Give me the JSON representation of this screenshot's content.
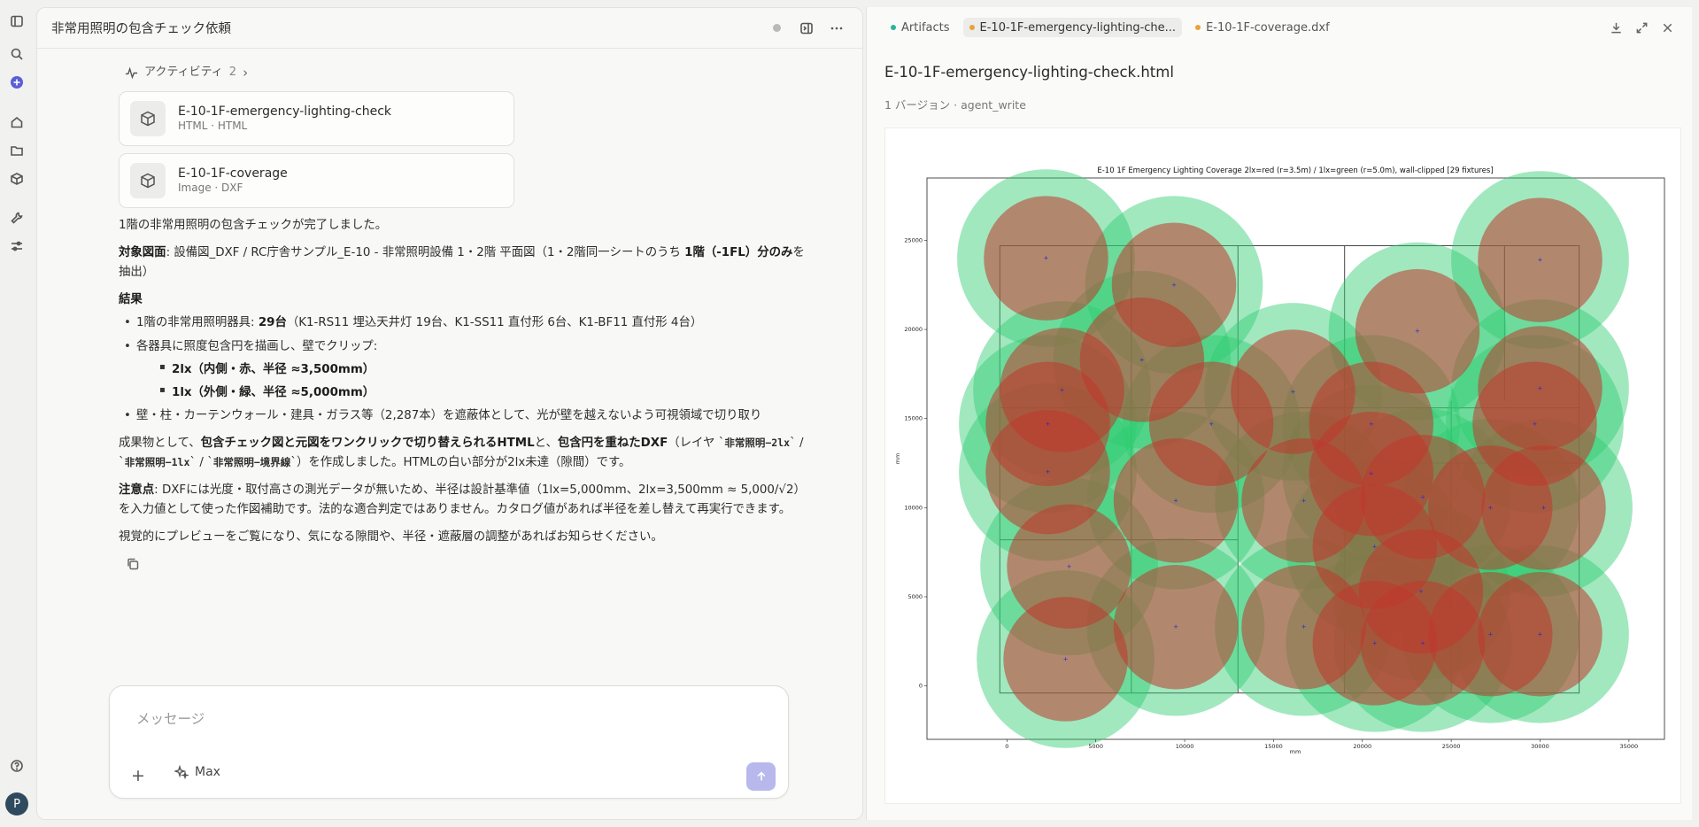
{
  "rail": {
    "icons": [
      "sidebar-toggle-icon",
      "search-icon",
      "new-chat-icon",
      "home-icon",
      "folder-icon",
      "artifacts-icon",
      "tools-icon",
      "settings-sliders-icon",
      "help-icon"
    ],
    "avatar_letter": "P",
    "accent": "#5a5fd6"
  },
  "chat": {
    "title": "非常用照明の包含チェック依頼",
    "activity_label": "アクティビティ",
    "activity_count": "2",
    "artifacts": [
      {
        "name": "E-10-1F-emergency-lighting-check",
        "sub": "HTML · HTML"
      },
      {
        "name": "E-10-1F-coverage",
        "sub": "Image · DXF"
      }
    ],
    "p1": "1階の非常用照明の包含チェックが完了しました。",
    "p2_bold": "対象図面",
    "p2_a": ": 設備図_DXF / RC庁舎サンプル_E-10 - 非常照明設備 1・2階 平面図（1・2階同一シートのうち ",
    "p2_bold2": "1階（-1FL）分のみ",
    "p2_b": "を抽出）",
    "result_heading": "結果",
    "b1_a": "1階の非常用照明器具: ",
    "b1_bold": "29台",
    "b1_b": "（K1-RS11 埋込天井灯 19台、K1-SS11 直付形 6台、K1-BF11 直付形 4台）",
    "b2": "各器具に照度包含円を描画し、壁でクリップ:",
    "sub1": "2lx（内側・赤、半径 ≈3,500mm）",
    "sub2": "1lx（外側・緑、半径 ≈5,000mm）",
    "b3": "壁・柱・カーテンウォール・建具・ガラス等（2,287本）を遮蔽体として、光が壁を越えないよう可視領域で切り取り",
    "p4_a": "成果物として、",
    "p4_bold": "包含チェック図と元図をワンクリックで切り替えられるHTML",
    "p4_b": "と、",
    "p4_bold2": "包含円を重ねたDXF",
    "p4_c": "（レイヤ `",
    "p4_code1": "非常照明−2lx",
    "p4_d": "` / `",
    "p4_code2": "非常照明−1lx",
    "p4_e": "` / `",
    "p4_code3": "非常照明−境界線",
    "p4_f": "`）を作成しました。HTMLの白い部分が2lx未達（隙間）です。",
    "p5_bold": "注意点",
    "p5": ": DXFには光度・取付高さの測光データが無いため、半径は設計基準値（1lx=5,000mm、2lx=3,500mm ≈ 5,000/√2）を入力値として使った作図補助です。法的な適合判定ではありません。カタログ値があれば半径を差し替えて再実行できます。",
    "p6": "視覚的にプレビューをご覧になり、気になる隙間や、半径・遮蔽層の調整があればお知らせください。",
    "composer_placeholder": "メッセージ",
    "model_label": "Max"
  },
  "artifacts_pane": {
    "tab_artifacts": "Artifacts",
    "tab1": "E-10-1F-emergency-lighting-che...",
    "tab2": "E-10-1F-coverage.dxf",
    "title": "E-10-1F-emergency-lighting-check.html",
    "meta": "1 バージョン · agent_write",
    "tab_dot_teal": "#2bb39a",
    "tab_dot_orange": "#e8a23a"
  },
  "chart_data": {
    "type": "scatter",
    "title": "E-10 1F Emergency Lighting Coverage   2lx=red (r=3.5m) / 1lx=green (r=5.0m), wall-clipped   [29 fixtures]",
    "xlabel": "mm",
    "ylabel": "mm",
    "xlim": [
      -4500,
      37000
    ],
    "ylim": [
      -3000,
      28500
    ],
    "xticks": [
      0,
      5000,
      10000,
      15000,
      20000,
      25000,
      30000,
      35000
    ],
    "yticks": [
      0,
      5000,
      10000,
      15000,
      20000,
      25000
    ],
    "colors": {
      "red": "#c0392b",
      "green": "#2ecc71",
      "brown": "#b4705e",
      "fixture": "#2a2ad0"
    },
    "radius_2lx": 3500,
    "radius_1lx": 5000,
    "fixtures": [
      {
        "x": 2200,
        "y": 24000
      },
      {
        "x": 9400,
        "y": 22500
      },
      {
        "x": 23100,
        "y": 19900
      },
      {
        "x": 30000,
        "y": 23900
      },
      {
        "x": 7600,
        "y": 18300
      },
      {
        "x": 3100,
        "y": 16600
      },
      {
        "x": 16100,
        "y": 16500
      },
      {
        "x": 30000,
        "y": 16700
      },
      {
        "x": 2300,
        "y": 14700
      },
      {
        "x": 11500,
        "y": 14700
      },
      {
        "x": 20500,
        "y": 14700
      },
      {
        "x": 29700,
        "y": 14700
      },
      {
        "x": 2300,
        "y": 12000
      },
      {
        "x": 20500,
        "y": 11900
      },
      {
        "x": 9500,
        "y": 10400
      },
      {
        "x": 16700,
        "y": 10400
      },
      {
        "x": 23400,
        "y": 10600
      },
      {
        "x": 27200,
        "y": 10000
      },
      {
        "x": 30200,
        "y": 10000
      },
      {
        "x": 20700,
        "y": 7800
      },
      {
        "x": 3500,
        "y": 6700
      },
      {
        "x": 23300,
        "y": 5300
      },
      {
        "x": 9500,
        "y": 3300
      },
      {
        "x": 16700,
        "y": 3300
      },
      {
        "x": 27200,
        "y": 2900
      },
      {
        "x": 30000,
        "y": 2900
      },
      {
        "x": 20700,
        "y": 2400
      },
      {
        "x": 23400,
        "y": 2400
      },
      {
        "x": 3300,
        "y": 1500
      }
    ]
  }
}
